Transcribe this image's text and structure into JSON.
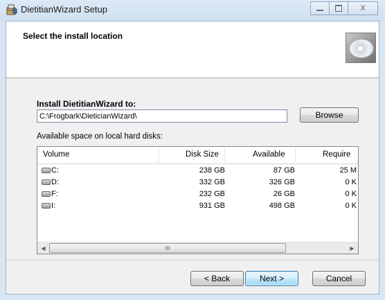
{
  "window": {
    "title": "DietitianWizard Setup",
    "minimize_icon": "minimize-icon",
    "maximize_icon": "maximize-icon",
    "close_label": "X"
  },
  "banner": {
    "title": "Select the install location",
    "image_icon": "cd-disc-icon"
  },
  "install": {
    "label": "Install DietitianWizard to:",
    "path_value": "C:\\Frogbark\\DieticianWizard\\",
    "browse_label": "Browse"
  },
  "disks": {
    "label": "Available space on local hard disks:",
    "columns": [
      "Volume",
      "Disk Size",
      "Available",
      "Require"
    ],
    "rows": [
      {
        "volume": "C:",
        "size": "238 GB",
        "available": "87 GB",
        "required": "25 M"
      },
      {
        "volume": "D:",
        "size": "332 GB",
        "available": "326 GB",
        "required": "0 K"
      },
      {
        "volume": "F:",
        "size": "232 GB",
        "available": "26 GB",
        "required": "0 K"
      },
      {
        "volume": "I:",
        "size": "931 GB",
        "available": "498 GB",
        "required": "0 K"
      }
    ],
    "scroll_left": "◀",
    "scroll_right": "▶",
    "scroll_grip": "III"
  },
  "buttons": {
    "back": "< Back",
    "next": "Next >",
    "cancel": "Cancel"
  },
  "colors": {
    "title_bar": "#d8e6f3",
    "next_button_border": "#3c7fb1"
  }
}
